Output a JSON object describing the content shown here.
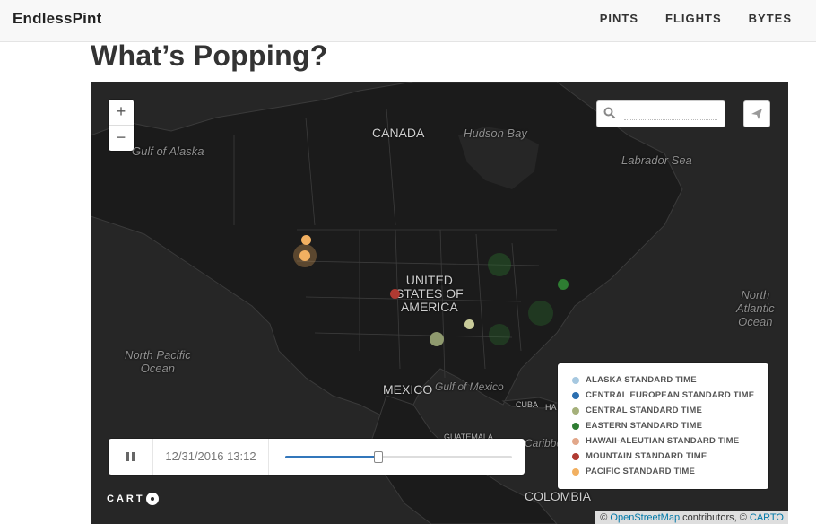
{
  "brand": "EndlessPint",
  "nav": [
    "PINTS",
    "FLIGHTS",
    "BYTES"
  ],
  "page_title": "What’s Popping?",
  "map": {
    "zoom_in": "+",
    "zoom_out": "−",
    "search_placeholder": "",
    "labels": {
      "canada": "CANADA",
      "hudson_bay": "Hudson Bay",
      "labrador_sea": "Labrador Sea",
      "gulf_alaska": "Gulf of Alaska",
      "usa": "UNITED\nSTATES OF\nAMERICA",
      "north_pacific": "North Pacific\nOcean",
      "north_atlantic": "North\nAtlantic\nOcean",
      "mexico": "MEXICO",
      "gulf_mexico": "Gulf of Mexico",
      "cuba": "CUBA",
      "ha": "HA",
      "guatemala": "GUATEMALA",
      "caribbean": "Caribbea",
      "colombia": "COLOMBIA"
    }
  },
  "legend": [
    {
      "label": "ALASKA STANDARD TIME",
      "color": "#a6c8e0"
    },
    {
      "label": "CENTRAL EUROPEAN STANDARD TIME",
      "color": "#2b6fb0"
    },
    {
      "label": "CENTRAL STANDARD TIME",
      "color": "#a5b07a"
    },
    {
      "label": "EASTERN STANDARD TIME",
      "color": "#2e7d32"
    },
    {
      "label": "HAWAII-ALEUTIAN STANDARD TIME",
      "color": "#e2a78a"
    },
    {
      "label": "MOUNTAIN STANDARD TIME",
      "color": "#b03a32"
    },
    {
      "label": "PACIFIC STANDARD TIME",
      "color": "#f2b061"
    }
  ],
  "timeline": {
    "timestamp": "12/31/2016 13:12",
    "progress": 0.41
  },
  "carto_logo": "CARTO",
  "attribution": {
    "prefix": "© ",
    "osm": "OpenStreetMap",
    "middle": " contributors, © ",
    "carto": "CARTO"
  }
}
